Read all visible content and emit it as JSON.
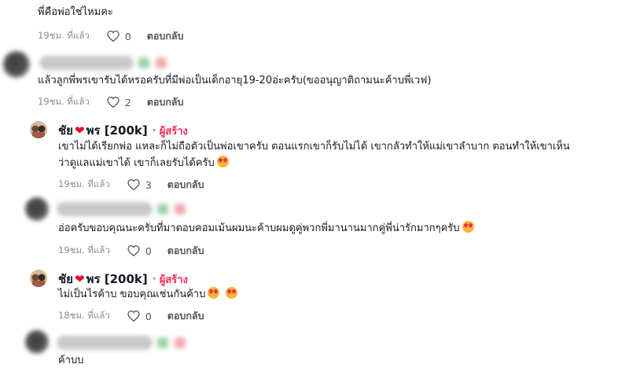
{
  "comments": [
    {
      "text": "พี่คือพ่อใช่ไหมคะ",
      "time": "19ชม. ที่แล้ว",
      "likes": "0",
      "reply": "ตอบกลับ"
    },
    {
      "text": "แล้วลูกพี่พรเขารับได้หรอครับที่มีพ่อเป็นเด็กอายุ19-20อ่ะครับ(ขออนุญาติถามนะค้าบพี่เวฟ)",
      "time": "19ชม. ที่แล้ว",
      "likes": "2",
      "reply": "ตอบกลับ"
    },
    {
      "name": "ชัย",
      "name2": "พร [200k]",
      "dot": "·",
      "creator_label": "ผู้สร้าง",
      "line1": "เขาไม่ได้เรียกพ่อ แหละก็ไม่ถือตัวเป็นพ่อเขาครับ ตอนแรกเขาก็รับไม่ได้ เขากลัวทำให้แม่เขาลำบาก ตอนทำให้เขาเห็น",
      "line2": "ว่าดูแลแม่เขาได้ เขาก็เลยรับได้ครับ",
      "time": "19ชม. ที่แล้ว",
      "likes": "3",
      "reply": "ตอบกลับ"
    },
    {
      "text": "อ่อครับขอบคุณนะครับที่มาตอบคอมเม้นผมนะค้าบผมดูคู่พวกพี่มานานมากคู่พี่น่ารักมากๆครับ",
      "time": "19ชม. ที่แล้ว",
      "likes": "0",
      "reply": "ตอบกลับ"
    },
    {
      "name": "ชัย",
      "name2": "พร [200k]",
      "dot": "·",
      "creator_label": "ผู้สร้าง",
      "text": "ไม่เป็นไรค้าบ ขอบคุณเช่นกันค้าบ",
      "time": "18ชม. ที่แล้ว",
      "likes": "0",
      "reply": "ตอบกลับ"
    },
    {
      "text": "ค้าบบ"
    }
  ],
  "icons": {
    "like": "heart-outline-icon",
    "emoji": "smiling-face-with-hearts-emoji"
  }
}
